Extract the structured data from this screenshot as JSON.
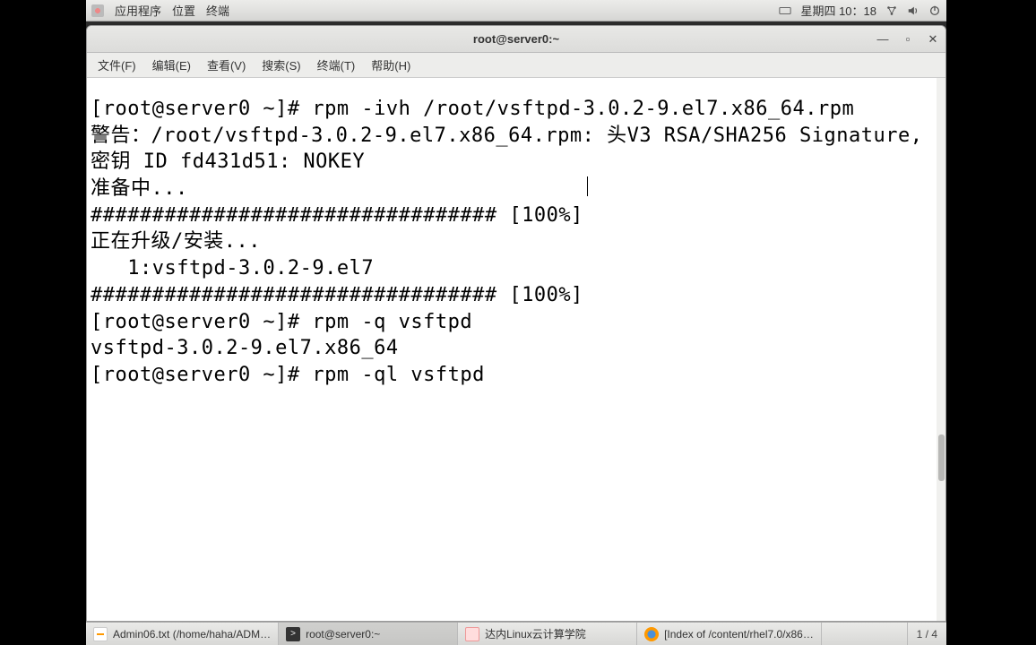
{
  "top_panel": {
    "app_menu": "应用程序",
    "places": "位置",
    "terminal": "终端",
    "datetime": "星期四 10：18"
  },
  "window": {
    "title": "root@server0:~",
    "menus": {
      "file": "文件(F)",
      "edit": "编辑(E)",
      "view": "查看(V)",
      "search": "搜索(S)",
      "terminal": "终端(T)",
      "help": "帮助(H)"
    }
  },
  "terminal": {
    "output": "[root@server0 ~]# rpm -ivh /root/vsftpd-3.0.2-9.el7.x86_64.rpm\n警告：/root/vsftpd-3.0.2-9.el7.x86_64.rpm: 头V3 RSA/SHA256 Signature, 密钥 ID fd431d51: NOKEY\n准备中...\n################################# [100%]\n正在升级/安装...\n   1:vsftpd-3.0.2-9.el7\n################################# [100%]\n[root@server0 ~]# rpm -q vsftpd\nvsftpd-3.0.2-9.el7.x86_64\n[root@server0 ~]# rpm -ql vsftpd"
  },
  "taskbar": {
    "items": [
      "Admin06.txt (/home/haha/ADM…",
      "root@server0:~",
      "达内Linux云计算学院",
      "[Index of /content/rhel7.0/x86…"
    ],
    "workspace": "1 / 4"
  }
}
